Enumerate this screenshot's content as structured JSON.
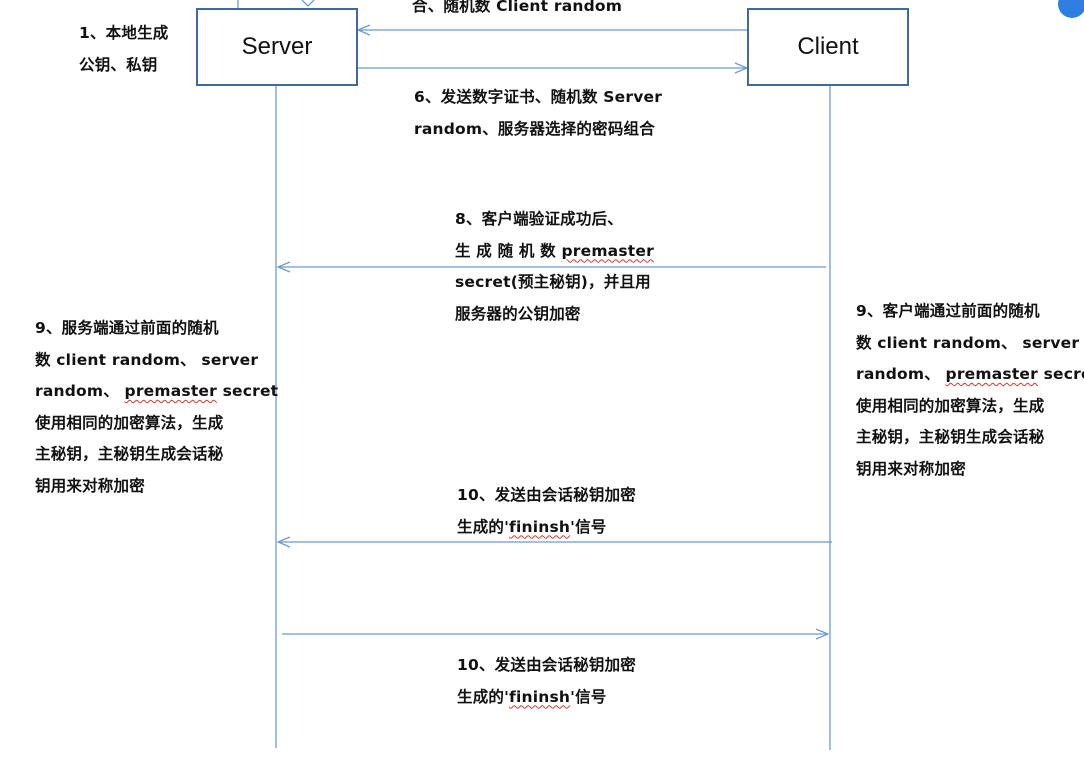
{
  "colors": {
    "line": "#6b9bd2",
    "box_border": "#41699a",
    "badge": "#2f7fe3",
    "squiggle": "#d23a2e"
  },
  "server_label": "Server",
  "client_label": "Client",
  "notes": {
    "top_cut": "合、随机数 Client random",
    "step1": {
      "line1": "1、本地生成",
      "line2": "公钥、私钥"
    },
    "step6": {
      "line1": "6、发送数字证书、随机数 Server",
      "line2": "random、服务器选择的密码组合"
    },
    "step8": {
      "line1": "8、客户端验证成功后、",
      "line2_prefix": "生 成 随 机 数 ",
      "line2_word": "premaster",
      "line3": "secret(预主秘钥)，并且用",
      "line4": "服务器的公钥加密"
    },
    "step9_server": {
      "line1": "9、服务端通过前面的随机",
      "line2": "数 client random、 server",
      "line3_prefix": "random、 ",
      "line3_word": "premaster",
      "line3_suffix": " secret",
      "line4": "使用相同的加密算法，生成",
      "line5": "主秘钥，主秘钥生成会话秘",
      "line6": "钥用来对称加密"
    },
    "step9_client": {
      "line1": "9、客户端通过前面的随机",
      "line2": "数 client random、 server",
      "line3_prefix": "random、 ",
      "line3_word": "premaster",
      "line3_suffix": " secret",
      "line4": "使用相同的加密算法，生成",
      "line5": "主秘钥，主秘钥生成会话秘",
      "line6": "钥用来对称加密"
    },
    "step10a": {
      "line1": "10、发送由会话秘钥加密",
      "line2_prefix": "生成的'",
      "line2_word": "fininsh",
      "line2_suffix": "'信号"
    },
    "step10b": {
      "line1": "10、发送由会话秘钥加密",
      "line2_prefix": "生成的'",
      "line2_word": "fininsh",
      "line2_suffix": "'信号"
    }
  }
}
